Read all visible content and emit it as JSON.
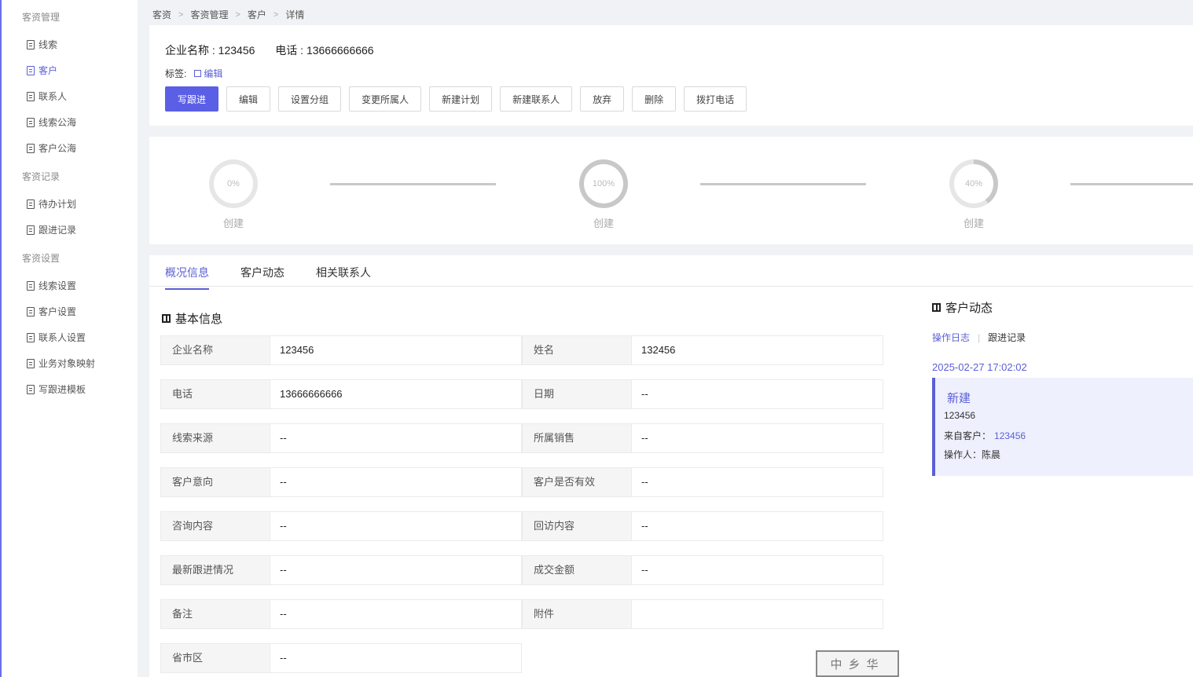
{
  "sidebar": {
    "groups": [
      {
        "label": "客资管理",
        "items": [
          "线索",
          "客户",
          "联系人",
          "线索公海",
          "客户公海"
        ]
      },
      {
        "label": "客资记录",
        "items": [
          "待办计划",
          "跟进记录"
        ]
      },
      {
        "label": "客资设置",
        "items": [
          "线索设置",
          "客户设置",
          "联系人设置",
          "业务对象映射",
          "写跟进模板"
        ]
      }
    ],
    "active_item": "客户"
  },
  "breadcrumb": [
    "客资",
    "客资管理",
    "客户",
    "详情"
  ],
  "header": {
    "company_label": "企业名称 : 123456",
    "phone_label": "电话 : 13666666666",
    "tags_label": "标签:",
    "edit_label": "编辑",
    "actions": [
      "写跟进",
      "编辑",
      "设置分组",
      "变更所属人",
      "新建计划",
      "新建联系人",
      "放弃",
      "删除",
      "拨打电话"
    ]
  },
  "progress": {
    "steps": [
      {
        "percent": 0,
        "percent_label": "0%",
        "label": "创建"
      },
      {
        "percent": 100,
        "percent_label": "100%",
        "label": "创建"
      },
      {
        "percent": 40,
        "percent_label": "40%",
        "label": "创建"
      }
    ]
  },
  "tabs": [
    "概况信息",
    "客户动态",
    "相关联系人"
  ],
  "active_tab": "概况信息",
  "basic_info": {
    "title": "基本信息",
    "rows": [
      [
        {
          "label": "企业名称",
          "value": "123456"
        },
        {
          "label": "姓名",
          "value": "132456"
        }
      ],
      [
        {
          "label": "电话",
          "value": "13666666666"
        },
        {
          "label": "日期",
          "value": "--"
        }
      ],
      [
        {
          "label": "线索来源",
          "value": "--"
        },
        {
          "label": "所属销售",
          "value": "--"
        }
      ],
      [
        {
          "label": "客户意向",
          "value": "--"
        },
        {
          "label": "客户是否有效",
          "value": "--"
        }
      ],
      [
        {
          "label": "咨询内容",
          "value": "--"
        },
        {
          "label": "回访内容",
          "value": "--"
        }
      ],
      [
        {
          "label": "最新跟进情况",
          "value": "--"
        },
        {
          "label": "成交金额",
          "value": "--"
        }
      ],
      [
        {
          "label": "备注",
          "value": "--"
        },
        {
          "label": "附件",
          "value": ""
        }
      ],
      [
        {
          "label": "省市区",
          "value": "--"
        }
      ]
    ]
  },
  "activity": {
    "title": "客户动态",
    "tabs": [
      "操作日志",
      "跟进记录"
    ],
    "active_tab": "操作日志",
    "time": "2025-02-27 17:02:02",
    "entry": {
      "title": "新建",
      "line1": "123456",
      "from_label": "来自客户：",
      "from_value": "123456",
      "operator_label": "操作人：陈晨"
    }
  },
  "stamp_text": "中乡华",
  "colors": {
    "accent": "#5b5fd6",
    "ring": "#c8c8c8",
    "ring_track": "#e6e6e6"
  }
}
